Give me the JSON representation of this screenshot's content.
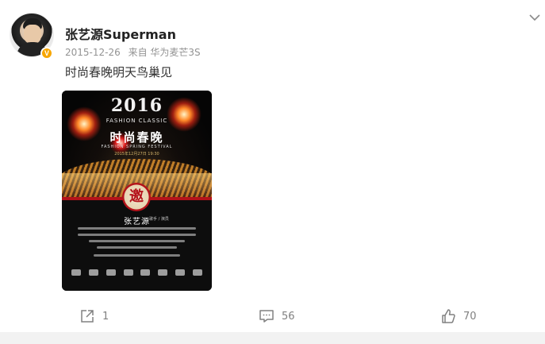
{
  "post": {
    "user": {
      "name": "张艺源Superman",
      "verified_badge": "V"
    },
    "date": "2015-12-26",
    "source": "来自 华为麦芒3S",
    "text": "时尚春晚明天鸟巢见",
    "poster": {
      "year": "2016",
      "fashion_classic": "FASHION CLASSIC",
      "title": "时尚春晚",
      "subtitle": "FASHION SPRING FESTIVAL",
      "date_info": "2015年12月27日 19:30",
      "seal_char": "邀",
      "guest_name": "张艺源",
      "guest_roles": "歌手 / 演员"
    }
  },
  "actions": {
    "repost_count": "1",
    "comment_count": "56",
    "like_count": "70"
  },
  "colors": {
    "username": "#222222",
    "meta": "#939393",
    "badge": "#f7a600",
    "action": "#808080"
  },
  "icons": [
    "chevron-down-icon",
    "repost-icon",
    "comment-icon",
    "like-icon",
    "verified-icon"
  ]
}
